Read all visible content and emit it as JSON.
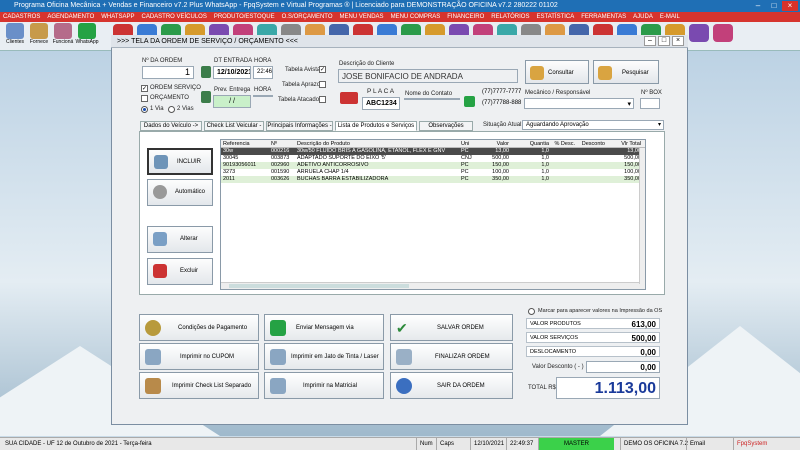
{
  "titlebar": {
    "title": "Programa Oficina Mecânica + Vendas e Financeiro v7.2 Plus WhatsApp - FpqSystem e Virtual Programas ® | Licenciado para  DEMONSTRAÇÃO OFICINA v7.2 280222 01102"
  },
  "menubar": {
    "items": [
      "CADASTROS",
      "AGENDAMENTO",
      "WHATSAPP",
      "CADASTRO VEÍCULOS",
      "PRODUTO/ESTOQUE",
      "O.S/ORÇAMENTO",
      "MENU VENDAS",
      "MENU COMPRAS",
      "FINANCEIRO",
      "RELATÓRIOS",
      "ESTATÍSTICA",
      "FERRAMENTAS",
      "AJUDA",
      "E-MAIL"
    ]
  },
  "toolbar": {
    "items": [
      {
        "label": "Clientes",
        "icon": "clients-icon",
        "color": "#6a8fc8"
      },
      {
        "label": "Fornece",
        "icon": "supplier-icon",
        "color": "#c79a4a"
      },
      {
        "label": "Funcioná",
        "icon": "employee-icon",
        "color": "#b56b8a"
      },
      {
        "label": "WhatsApp",
        "icon": "whatsapp-icon",
        "color": "#25a244"
      }
    ]
  },
  "window": {
    "title": ">>>  TELA DA ORDEM DE SERVIÇO / ORÇAMENTO  <<<",
    "order_label": "Nº DA ORDEM",
    "order_number": "1",
    "entry_label": "DT ENTRADA",
    "entry_date": "12/10/2021",
    "hour_label": "HORA",
    "entry_hour": "22:46",
    "prev_label": "Prev. Entrega",
    "prev_date": "/  /",
    "prev_hour_label": "HORA",
    "os_label": "ORDEM SERVIÇO",
    "orcamento_label": "ORÇAMENTO",
    "via1": "1 Via",
    "via2": "2 Vias",
    "tabela_avista": "Tabela Avista",
    "tabela_aprazo": "Tabela Aprazo",
    "tabela_atacado": "Tabela Atacado",
    "client_label": "Descrição do Cliente",
    "client_name": "JOSE BONIFACIO DE ANDRADA",
    "consultar": "Consultar",
    "pesquisar": "Pesquisar",
    "placa_label": "P L A C A",
    "placa": "ABC1234",
    "contato_label": "Nome do Contato",
    "contato": "",
    "phone1": "(77)7777-7777",
    "phone2": "(77)77788-8888",
    "mecanico_label": "Mecânico / Responsável",
    "box_label": "Nº BOX",
    "tabs": [
      "Dados do Veículo  ->",
      "Check List Veicular ->",
      "Principais Informações ->",
      "Lista de Produtos e Serviços  ->",
      "Observações Gerais"
    ],
    "situacao_label": "Situação Atual:",
    "situacao": "Aguardando Aprovação",
    "incluir": "INCLUIR",
    "automatico": "Automático",
    "alterar": "Alterar",
    "excluir": "Excluir",
    "grid": {
      "headers": [
        "Referencia",
        "Nº",
        "Descrição do Produto",
        "Uni",
        "Valor",
        "Quantia",
        "% Desc.",
        "Desconto",
        "Vlr Total"
      ],
      "rows": [
        [
          "30w",
          "000216",
          "30w/50 FLUIDO BRIS A GASOLINA, ETANOL, FLEX E GNV",
          "PC",
          "13,00",
          "1,0",
          "",
          "",
          "13,00"
        ],
        [
          "30045",
          "003873",
          "ADAPTADO SUPORTE DO EIXO '5'",
          "CNJ",
          "500,00",
          "1,0",
          "",
          "",
          "500,00"
        ],
        [
          "90193056011",
          "002960",
          "ADETIVO ANTICORROSIVO",
          "PC",
          "150,00",
          "1,0",
          "",
          "",
          "150,00"
        ],
        [
          "3273",
          "001590",
          "ARRUELA  CHAP  1/4",
          "PC",
          "100,00",
          "1,0",
          "",
          "",
          "100,00"
        ],
        [
          "2011",
          "003626",
          "BUCHAS BARRA ESTABILIZADORA",
          "PC",
          "350,00",
          "1,0",
          "",
          "",
          "350,00"
        ]
      ]
    },
    "buttons": {
      "condicoes": "Condições de Pagamento",
      "whatsapp": "Enviar Mensagem via WhatsApp",
      "salvar": "SALVAR ORDEM",
      "cupom": "Imprimir no CUPOM",
      "jato": "Imprimir em Jato de Tinta / Laser",
      "finalizar": "FINALIZAR ORDEM",
      "checklist": "Imprimir Check List Separado",
      "matricial": "Imprimir na Matricial",
      "sair": "SAIR DA ORDEM"
    },
    "totals": {
      "marcar": "Marcar para aparecer valores na Impressão da OS",
      "produtos_label": "VALOR PRODUTOS",
      "produtos": "613,00",
      "servicos_label": "VALOR SERVIÇOS",
      "servicos": "500,00",
      "deslocamento_label": "DESLOCAMENTO",
      "deslocamento": "0,00",
      "desconto_label": "Valor Desconto ( - )",
      "desconto": "0,00",
      "total_label": "TOTAL R$",
      "total": "1.113,00"
    }
  },
  "status": {
    "city": "SUA CIDADE  -  UF  12 de Outubro de 2021 - Terça-feira",
    "num": "Num",
    "caps": "Caps",
    "date": "12/10/2021",
    "time": "22:49:37",
    "master": "MASTER",
    "demo": "DEMO OS OFICINA 7.2",
    "email": "Email",
    "fpq": "FpqSystem"
  },
  "colors": {
    "menu": "#d6342e",
    "title": "#1f6fb5",
    "green": "#25a244"
  }
}
